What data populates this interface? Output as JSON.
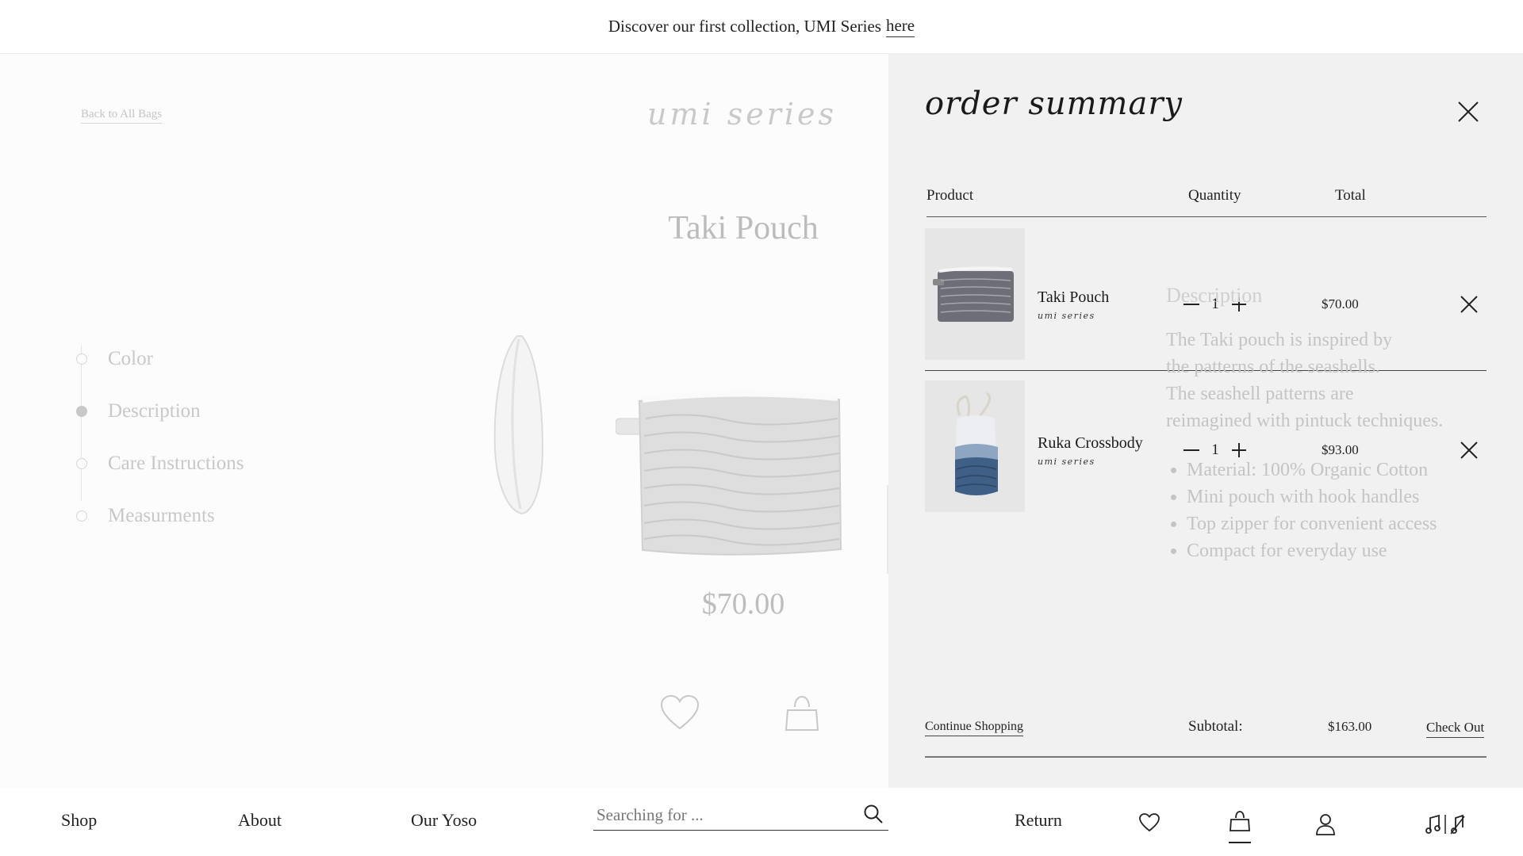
{
  "banner": {
    "text": "Discover our first collection, UMI Series",
    "link": "here"
  },
  "product_page": {
    "back_link": "Back to All Bags",
    "series_logo": "umi series",
    "title": "Taki Pouch",
    "price": "$70.00",
    "steps": [
      "Color",
      "Description",
      "Care Instructions",
      "Measurments"
    ],
    "active_step": "Description",
    "description": {
      "heading": "Description",
      "lines": [
        "The Taki pouch is inspired by",
        "the patterns of the seashells.",
        "The seashell patterns are",
        "reimagined with pintuck techniques."
      ],
      "bullets": [
        "Material: 100% Organic Cotton",
        "Mini pouch with hook handles",
        "Top zipper for convenient access",
        "Compact for everyday use"
      ]
    }
  },
  "drawer": {
    "title": "order summary",
    "columns": {
      "product": "Product",
      "quantity": "Quantity",
      "total": "Total"
    },
    "items": [
      {
        "name": "Taki Pouch",
        "series": "umi series",
        "quantity": "1",
        "price": "$70.00"
      },
      {
        "name": "Ruka Crossbody",
        "series": "umi series",
        "quantity": "1",
        "price": "$93.00"
      }
    ],
    "continue_label": "Continue Shopping",
    "subtotal_label": "Subtotal:",
    "subtotal_value": "$163.00",
    "checkout_label": "Check Out"
  },
  "nav": {
    "shop": "Shop",
    "about": "About",
    "our_yoso": "Our Yoso",
    "search_placeholder": "Searching for ...",
    "return": "Return",
    "icons": [
      "heart-icon",
      "bag-icon",
      "user-icon",
      "music-icon"
    ]
  },
  "colors": {
    "drawer_bg": "#f1f1f1",
    "dim_text": "#c8c8c8",
    "ink": "#222222",
    "denim": "#3f5f86"
  }
}
